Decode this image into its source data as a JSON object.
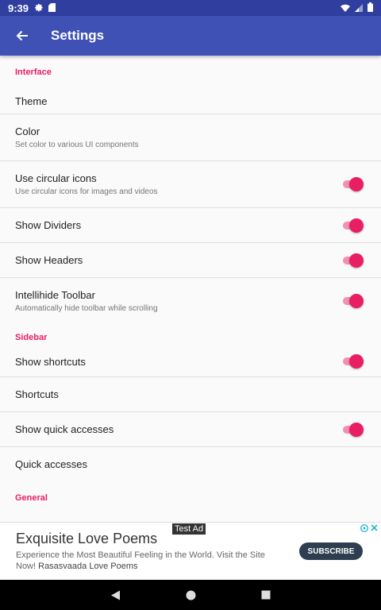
{
  "status_bar": {
    "time": "9:39"
  },
  "app_bar": {
    "title": "Settings"
  },
  "sections": {
    "interface": "Interface",
    "sidebar": "Sidebar",
    "general": "General"
  },
  "settings": {
    "theme": {
      "title": "Theme"
    },
    "color": {
      "title": "Color",
      "summary": "Set color to various UI components"
    },
    "circular_icons": {
      "title": "Use circular icons",
      "summary": "Use circular icons for images and videos",
      "enabled": true
    },
    "show_dividers": {
      "title": "Show Dividers",
      "enabled": true
    },
    "show_headers": {
      "title": "Show Headers",
      "enabled": true
    },
    "intellihide": {
      "title": "Intellihide Toolbar",
      "summary": "Automatically hide toolbar while scrolling",
      "enabled": true
    },
    "show_shortcuts": {
      "title": "Show shortcuts",
      "enabled": true
    },
    "shortcuts": {
      "title": "Shortcuts"
    },
    "show_quick_accesses": {
      "title": "Show quick accesses",
      "enabled": true
    },
    "quick_accesses": {
      "title": "Quick accesses"
    }
  },
  "ad": {
    "tag": "Test Ad",
    "headline": "Exquisite Love Poems",
    "body": "Experience the Most Beautiful Feeling in the World. Visit the Site Now!",
    "advertiser": "Rasasvaada Love Poems",
    "cta": "SUBSCRIBE"
  },
  "colors": {
    "primary": "#3f51b5",
    "primary_dark": "#303f9f",
    "accent": "#e91e63"
  }
}
